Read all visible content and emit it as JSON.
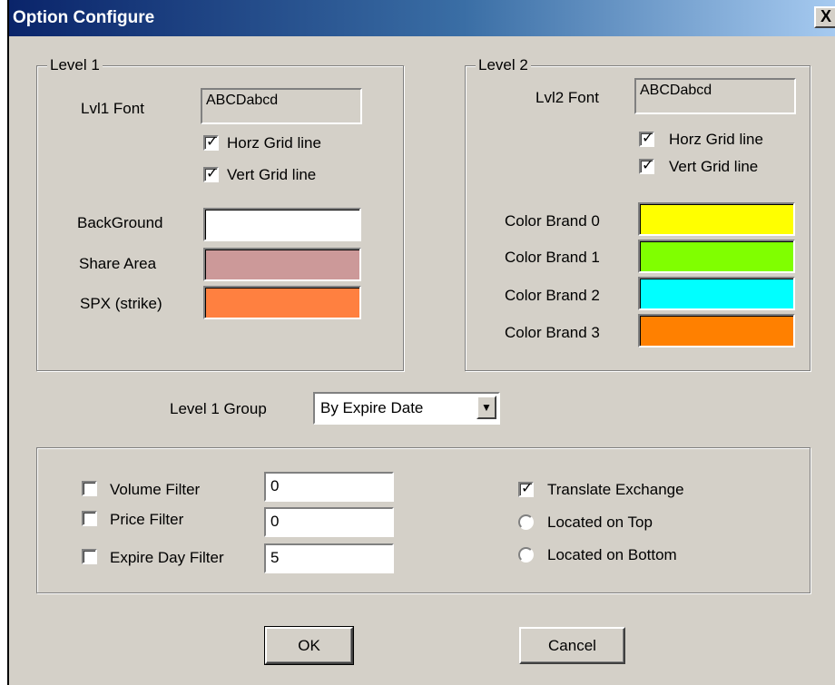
{
  "window": {
    "title": "Option Configure",
    "close_glyph": "X"
  },
  "level1": {
    "legend": "Level 1",
    "font_label": "Lvl1 Font",
    "font_sample": "ABCDabcd",
    "horz_grid": {
      "label": "Horz Grid line",
      "checked": true
    },
    "vert_grid": {
      "label": "Vert Grid line",
      "checked": true
    },
    "colors": [
      {
        "label": "BackGround",
        "color": "#ffffff"
      },
      {
        "label": "Share Area",
        "color": "#cc9999"
      },
      {
        "label": "SPX (strike)",
        "color": "#ff8040"
      }
    ]
  },
  "level2": {
    "legend": "Level 2",
    "font_label": "Lvl2 Font",
    "font_sample": "ABCDabcd",
    "horz_grid": {
      "label": "Horz Grid line",
      "checked": true
    },
    "vert_grid": {
      "label": "Vert Grid line",
      "checked": true
    },
    "colors": [
      {
        "label": "Color Brand 0",
        "color": "#ffff00"
      },
      {
        "label": "Color Brand 1",
        "color": "#80ff00"
      },
      {
        "label": "Color Brand 2",
        "color": "#00ffff"
      },
      {
        "label": "Color Brand 3",
        "color": "#ff8000"
      }
    ]
  },
  "group_select": {
    "label": "Level 1 Group",
    "value": "By Expire Date"
  },
  "filters": {
    "volume": {
      "label": "Volume Filter",
      "checked": false,
      "value": "0"
    },
    "price": {
      "label": "Price Filter",
      "checked": false,
      "value": "0"
    },
    "expire": {
      "label": "Expire Day Filter",
      "checked": false,
      "value": "5"
    },
    "translate": {
      "label": "Translate Exchange",
      "checked": true
    },
    "located_top": {
      "label": "Located on Top",
      "selected": false
    },
    "located_bottom": {
      "label": "Located on Bottom",
      "selected": false
    }
  },
  "buttons": {
    "ok": "OK",
    "cancel": "Cancel"
  },
  "check_glyph": "✓"
}
